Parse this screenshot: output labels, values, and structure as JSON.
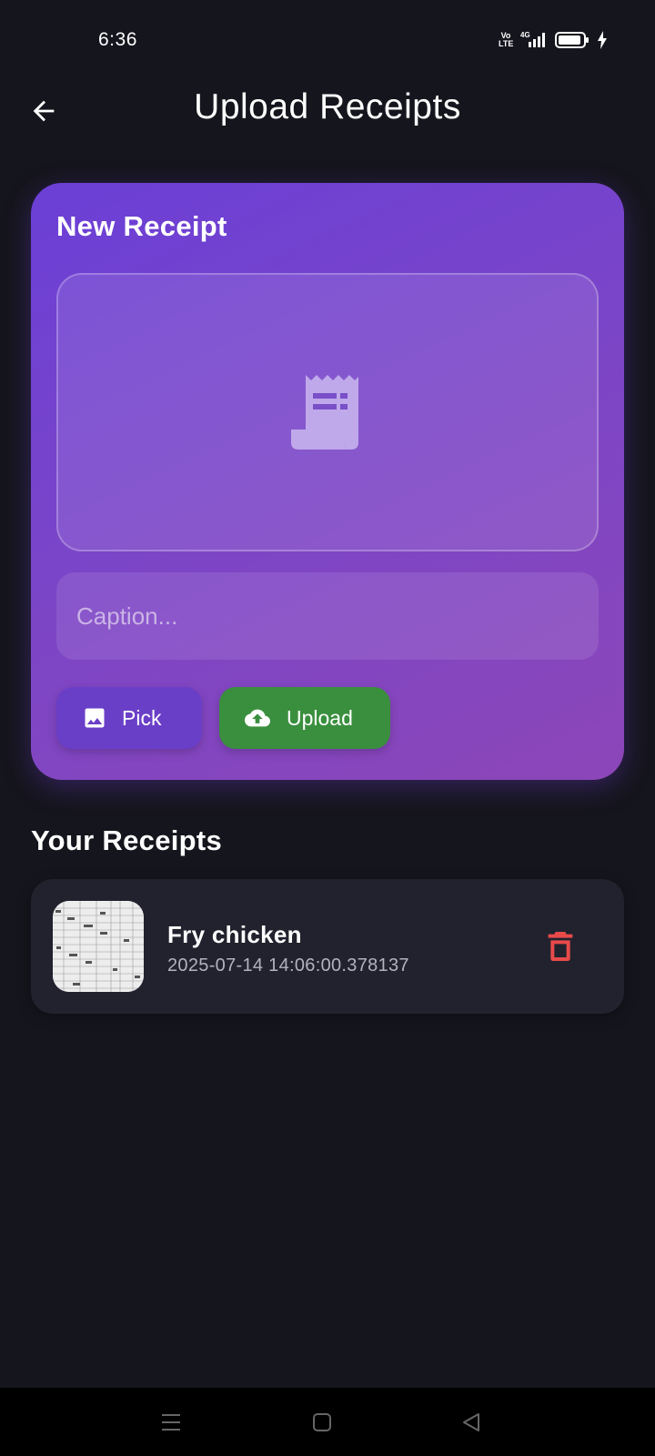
{
  "status_bar": {
    "time": "6:36",
    "volte_top": "Vo",
    "volte_bottom": "LTE",
    "network": "4G",
    "icons": [
      "signal-icon",
      "battery-icon",
      "charging-icon"
    ]
  },
  "app_bar": {
    "title": "Upload Receipts",
    "back_icon": "arrow-back-icon"
  },
  "new_receipt": {
    "title": "New Receipt",
    "preview_icon": "receipt-icon",
    "caption_placeholder": "Caption...",
    "caption_value": "",
    "pick_label": "Pick",
    "pick_icon": "image-icon",
    "upload_label": "Upload",
    "upload_icon": "cloud-upload-icon"
  },
  "receipts_section": {
    "title": "Your Receipts",
    "items": [
      {
        "title": "Fry chicken",
        "date": "2025-07-14 14:06:00.378137",
        "delete_icon": "trash-icon"
      }
    ]
  },
  "colors": {
    "background": "#15151d",
    "card_gradient_start": "#6b3fd6",
    "card_gradient_end": "#8c46b8",
    "pick_button": "#6a3fc8",
    "upload_button": "#3a8f3e",
    "list_item": "#22222e",
    "delete": "#e84a4a"
  },
  "nav_bar": {
    "icons": [
      "menu-icon",
      "home-icon",
      "back-triangle-icon"
    ]
  }
}
